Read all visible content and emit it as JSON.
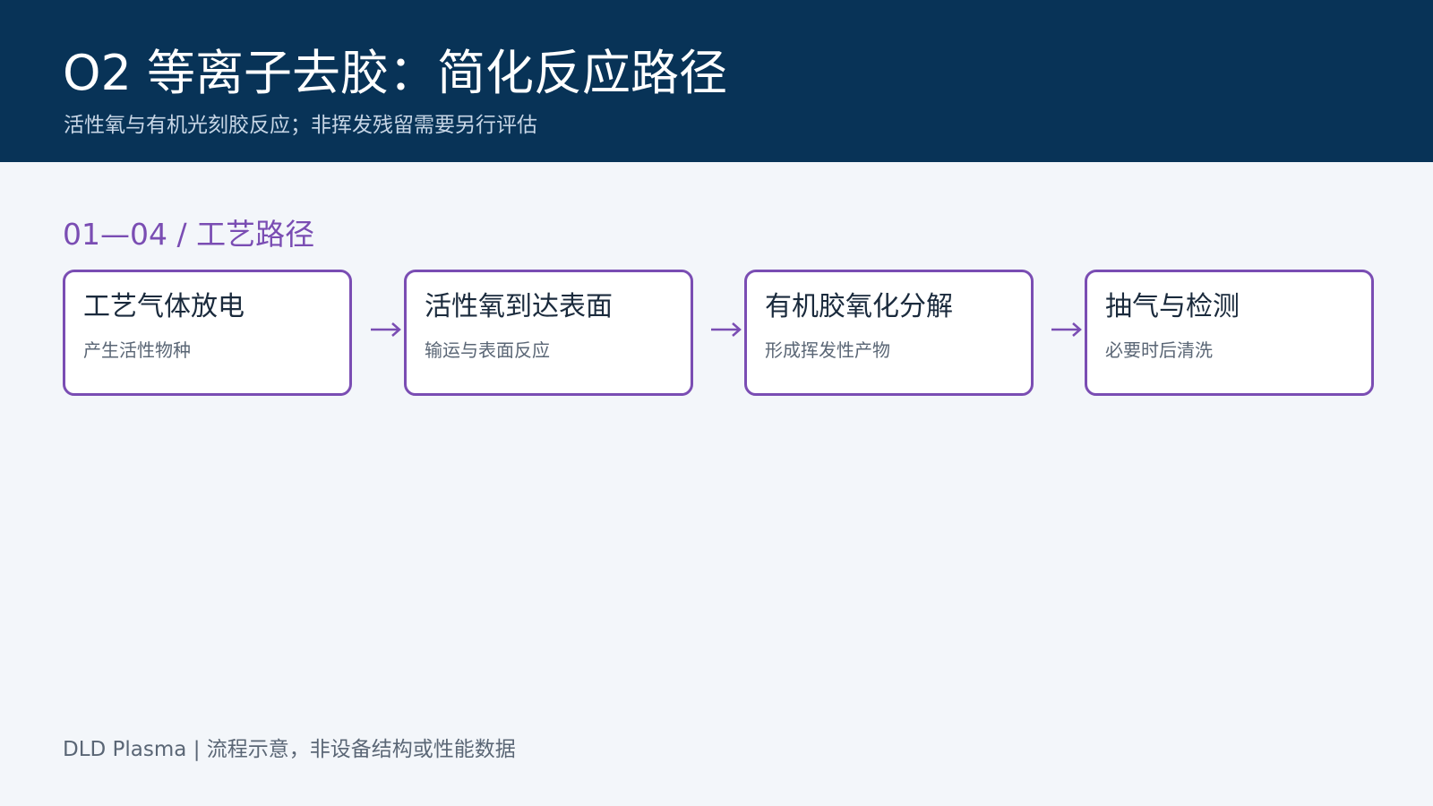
{
  "header": {
    "title": "O2 等离子去胶：简化反应路径",
    "subtitle": "活性氧与有机光刻胶反应；非挥发残留需要另行评估"
  },
  "section": {
    "label": "01—04  /  工艺路径"
  },
  "steps": [
    {
      "title": "工艺气体放电",
      "desc": "产生活性物种"
    },
    {
      "title": "活性氧到达表面",
      "desc": "输运与表面反应"
    },
    {
      "title": "有机胶氧化分解",
      "desc": "形成挥发性产物"
    },
    {
      "title": "抽气与检测",
      "desc": "必要时后清洗"
    }
  ],
  "footer": {
    "text": "DLD Plasma  |  流程示意，非设备结构或性能数据"
  },
  "colors": {
    "header_bg": "#083357",
    "accent": "#7a4db3",
    "page_bg": "#f3f6fa"
  },
  "icons": {
    "connector": "arrow-right-icon"
  }
}
